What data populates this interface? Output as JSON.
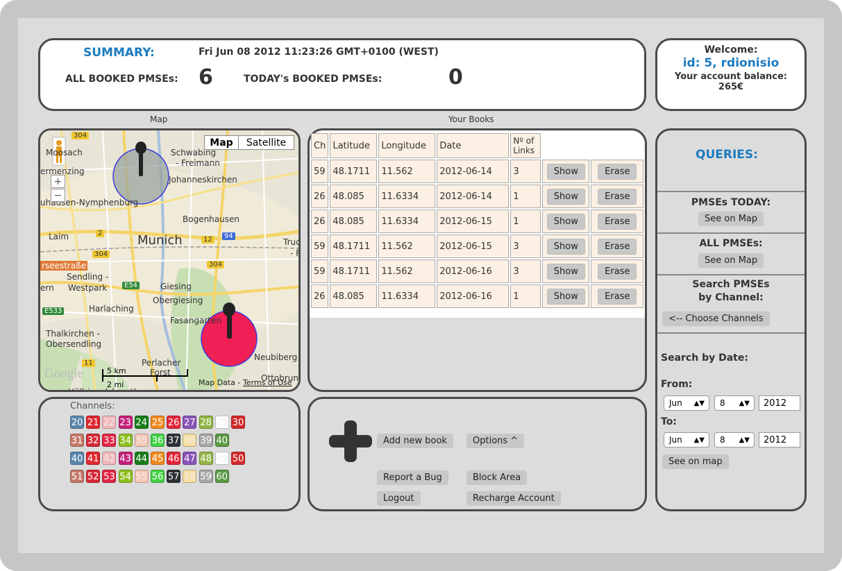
{
  "summary": {
    "title": "SUMMARY:",
    "datetime": "Fri Jun 08 2012 11:23:26 GMT+0100 (WEST)",
    "all_label": "ALL BOOKED PMSEs:",
    "all_value": "6",
    "today_label": "TODAY's BOOKED PMSEs:",
    "today_value": "0"
  },
  "welcome": {
    "greeting": "Welcome:",
    "user": "id: 5, rdionisio",
    "balance_label": "Your account balance:",
    "balance_value": "265€"
  },
  "captions": {
    "map": "Map",
    "books": "Your Books"
  },
  "map": {
    "type_map": "Map",
    "type_satellite": "Satellite",
    "zoom_in": "+",
    "zoom_out": "−",
    "labels": [
      "Moosach",
      "Schwabing",
      "- Freimann",
      "Johanneskirchen",
      "ermenzing",
      "uhausen-Nymphenburg",
      "Bogenhausen",
      "Laim",
      "Munich",
      "Trud",
      "- R",
      "rseestraße",
      "Sendling -",
      "ern",
      "Westpark",
      "Giesing",
      "Obergiesing",
      "Harlaching",
      "Fasangarten",
      "Thalkirchen -",
      "Obersendling",
      "Perlacher",
      "Forst",
      "Neubiberg",
      "Ottobrunn",
      "Höllriegelskreuth"
    ],
    "road_numbers": [
      "304",
      "2",
      "304",
      "12",
      "94",
      "304",
      "E54",
      "E533",
      "11"
    ],
    "scale_km": "5 km",
    "scale_mi": "2 mi",
    "attribution_data": "Map Data",
    "attribution_sep": " - ",
    "attribution_terms": "Terms of Use",
    "google": "Google"
  },
  "books": {
    "headers": [
      "Ch",
      "Latitude",
      "Longitude",
      "Date",
      "Nº of Links"
    ],
    "show_label": "Show",
    "erase_label": "Erase",
    "rows": [
      {
        "ch": "59",
        "lat": "48.1711",
        "lon": "11.562",
        "date": "2012-06-14",
        "links": "3"
      },
      {
        "ch": "26",
        "lat": "48.085",
        "lon": "11.6334",
        "date": "2012-06-14",
        "links": "1"
      },
      {
        "ch": "26",
        "lat": "48.085",
        "lon": "11.6334",
        "date": "2012-06-15",
        "links": "1"
      },
      {
        "ch": "59",
        "lat": "48.1711",
        "lon": "11.562",
        "date": "2012-06-15",
        "links": "3"
      },
      {
        "ch": "59",
        "lat": "48.1711",
        "lon": "11.562",
        "date": "2012-06-16",
        "links": "3"
      },
      {
        "ch": "26",
        "lat": "48.085",
        "lon": "11.6334",
        "date": "2012-06-16",
        "links": "1"
      }
    ]
  },
  "queries": {
    "title": "QUERIES:",
    "today_label": "PMSEs TODAY:",
    "today_button": "See on Map",
    "all_label": "ALL PMSEs:",
    "all_button": "See on Map",
    "channel_label_1": "Search PMSEs",
    "channel_label_2": "by Channel:",
    "channel_button": "<-- Choose Channels",
    "date_label": "Search by Date:",
    "from_label": "From:",
    "from_month": "Jun",
    "from_day": "8",
    "from_year": "2012",
    "to_label": "To:",
    "to_month": "Jun",
    "to_day": "8",
    "to_year": "2012",
    "date_button": "See on map"
  },
  "channels": {
    "label": "Channels:",
    "rows": [
      [
        {
          "n": "20",
          "c": "#5b86ad"
        },
        {
          "n": "21",
          "c": "#e0262e"
        },
        {
          "n": "22",
          "c": "#f2b8bb"
        },
        {
          "n": "23",
          "c": "#c2217a"
        },
        {
          "n": "24",
          "c": "#1a7d1a"
        },
        {
          "n": "25",
          "c": "#f08a1e"
        },
        {
          "n": "26",
          "c": "#e3263a"
        },
        {
          "n": "27",
          "c": "#8a54b8"
        },
        {
          "n": "28",
          "c": "#93b545"
        },
        {
          "n": "29",
          "c": "#ffffff"
        },
        {
          "n": "30",
          "c": "#d42a2a"
        }
      ],
      [
        {
          "n": "31",
          "c": "#c47a6a"
        },
        {
          "n": "32",
          "c": "#d42a37"
        },
        {
          "n": "33",
          "c": "#e02646"
        },
        {
          "n": "34",
          "c": "#8fbf23"
        },
        {
          "n": "35",
          "c": "#f7c8b6"
        },
        {
          "n": "36",
          "c": "#43d146"
        },
        {
          "n": "37",
          "c": "#2d3236"
        },
        {
          "n": "38",
          "c": "#f7dfa0"
        },
        {
          "n": "39",
          "c": "#a8a8a8"
        },
        {
          "n": "40",
          "c": "#5c9a46"
        }
      ],
      [
        {
          "n": "40",
          "c": "#5b86ad"
        },
        {
          "n": "41",
          "c": "#e0262e"
        },
        {
          "n": "42",
          "c": "#f2b8bb"
        },
        {
          "n": "43",
          "c": "#c2217a"
        },
        {
          "n": "44",
          "c": "#1a7d1a"
        },
        {
          "n": "45",
          "c": "#f08a1e"
        },
        {
          "n": "46",
          "c": "#e3263a"
        },
        {
          "n": "47",
          "c": "#8a54b8"
        },
        {
          "n": "48",
          "c": "#93b545"
        },
        {
          "n": "49",
          "c": "#ffffff"
        },
        {
          "n": "50",
          "c": "#d42a2a"
        }
      ],
      [
        {
          "n": "51",
          "c": "#c47a6a"
        },
        {
          "n": "52",
          "c": "#d42a37"
        },
        {
          "n": "53",
          "c": "#e02646"
        },
        {
          "n": "54",
          "c": "#8fbf23"
        },
        {
          "n": "55",
          "c": "#f7c8b6"
        },
        {
          "n": "56",
          "c": "#43d146"
        },
        {
          "n": "57",
          "c": "#2d3236"
        },
        {
          "n": "58",
          "c": "#f7dfa0"
        },
        {
          "n": "59",
          "c": "#a8a8a8"
        },
        {
          "n": "60",
          "c": "#5c9a46"
        }
      ]
    ]
  },
  "actions": {
    "add_icon": "plus-icon",
    "add_label": "Add new book",
    "options_label": "Options ^",
    "bug_label": "Report a Bug",
    "block_label": "Block Area",
    "logout_label": "Logout",
    "recharge_label": "Recharge Account"
  }
}
